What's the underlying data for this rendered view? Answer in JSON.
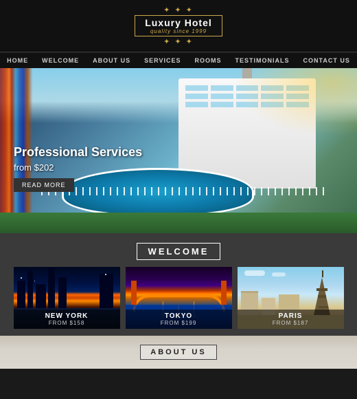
{
  "header": {
    "ornament_top": "✦ ✦ ✦",
    "logo_title": "Luxury Hotel",
    "logo_subtitle": "quality since 1999",
    "ornament_bottom": "✦ ✦ ✦"
  },
  "nav": {
    "items": [
      {
        "label": "HOME",
        "id": "home"
      },
      {
        "label": "WELCOME",
        "id": "welcome"
      },
      {
        "label": "ABOUT US",
        "id": "about-us"
      },
      {
        "label": "SERVICES",
        "id": "services"
      },
      {
        "label": "ROOMS",
        "id": "rooms"
      },
      {
        "label": "TESTIMONIALS",
        "id": "testimonials"
      },
      {
        "label": "CONTACT US",
        "id": "contact"
      }
    ]
  },
  "hero": {
    "headline": "Professional Services",
    "price": "from $202",
    "cta_label": "READ MORE"
  },
  "welcome": {
    "title": "WELCOME",
    "cards": [
      {
        "city": "NEW YORK",
        "price": "FROM $158",
        "id": "new-york"
      },
      {
        "city": "TOKYO",
        "price": "FROM $199",
        "id": "tokyo"
      },
      {
        "city": "PARIS",
        "price": "FROM $187",
        "id": "paris"
      }
    ]
  },
  "about": {
    "title": "ABOUT US"
  }
}
